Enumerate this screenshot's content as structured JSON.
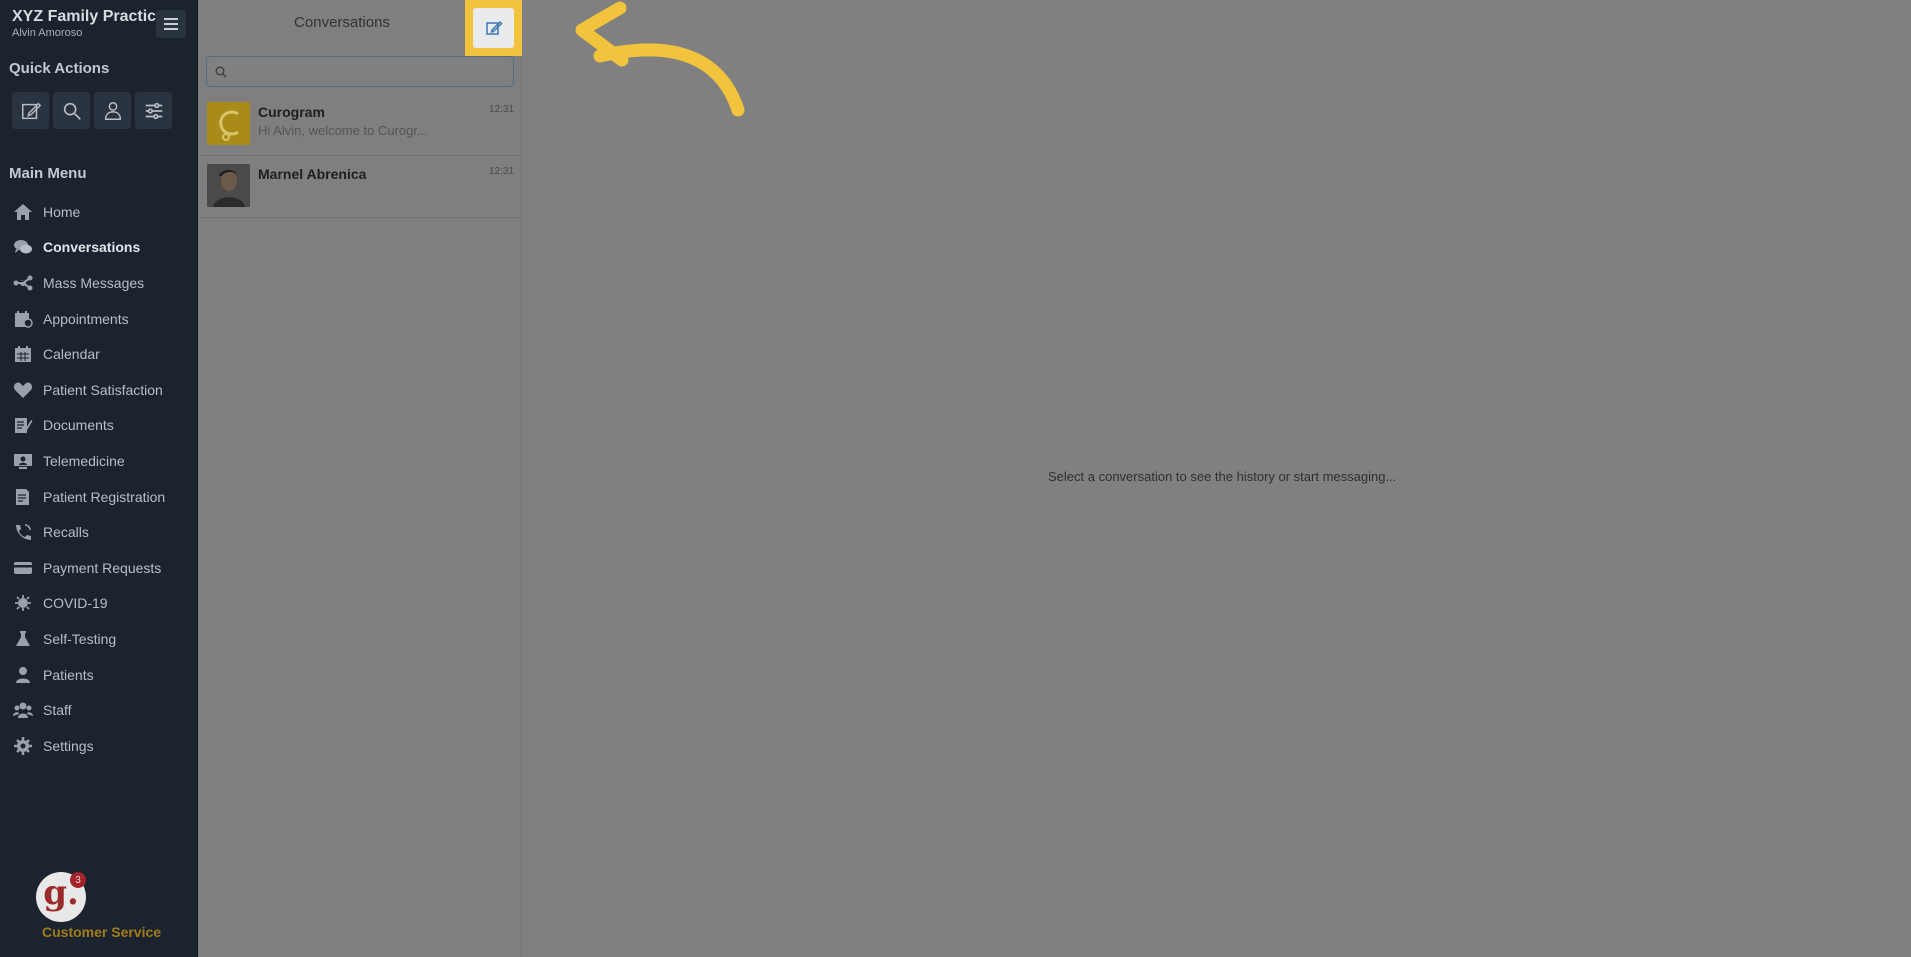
{
  "practice": {
    "name": "XYZ Family Practice",
    "user": "Alvin Amoroso"
  },
  "sidebar": {
    "quick_actions_title": "Quick Actions",
    "main_menu_title": "Main Menu",
    "items": [
      {
        "label": "Home",
        "icon": "home-icon",
        "active": false
      },
      {
        "label": "Conversations",
        "icon": "chat-icon",
        "active": true
      },
      {
        "label": "Mass Messages",
        "icon": "broadcast-icon",
        "active": false
      },
      {
        "label": "Appointments",
        "icon": "appointments-icon",
        "active": false
      },
      {
        "label": "Calendar",
        "icon": "calendar-icon",
        "active": false
      },
      {
        "label": "Patient Satisfaction",
        "icon": "heart-icon",
        "active": false
      },
      {
        "label": "Documents",
        "icon": "documents-icon",
        "active": false
      },
      {
        "label": "Telemedicine",
        "icon": "telemedicine-icon",
        "active": false
      },
      {
        "label": "Patient Registration",
        "icon": "registration-icon",
        "active": false
      },
      {
        "label": "Recalls",
        "icon": "phone-icon",
        "active": false
      },
      {
        "label": "Payment Requests",
        "icon": "credit-card-icon",
        "active": false
      },
      {
        "label": "COVID-19",
        "icon": "virus-icon",
        "active": false
      },
      {
        "label": "Self-Testing",
        "icon": "flask-icon",
        "active": false
      },
      {
        "label": "Patients",
        "icon": "user-icon",
        "active": false
      },
      {
        "label": "Staff",
        "icon": "users-icon",
        "active": false
      },
      {
        "label": "Settings",
        "icon": "gear-icon",
        "active": false
      }
    ],
    "customer_service": {
      "label": "Customer Service",
      "badge": "3",
      "logo_letter": "g."
    }
  },
  "conversations": {
    "title": "Conversations",
    "search_placeholder": "",
    "items": [
      {
        "name": "Curogram",
        "preview": "Hi Alvin, welcome to Curogr...",
        "time": "12:31"
      },
      {
        "name": "Marnel Abrenica",
        "preview": "",
        "time": "12:31"
      }
    ]
  },
  "main": {
    "empty_message": "Select a conversation to see the history or start messaging..."
  },
  "colors": {
    "sidebar_bg": "#1b232e",
    "highlight": "#f2c33c",
    "overlay": "#808080",
    "brand_red": "#9b2a2a"
  }
}
